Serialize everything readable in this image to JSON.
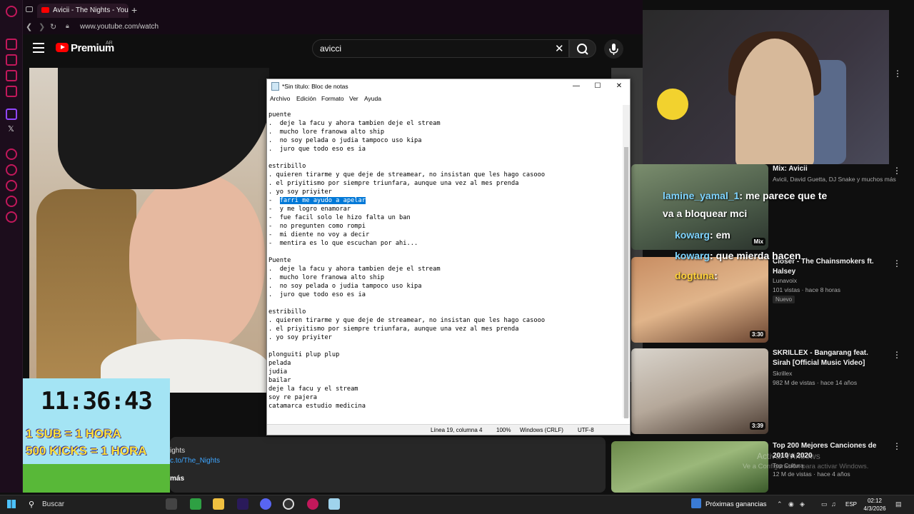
{
  "browser": {
    "tab_title": "Avicii - The Nights - YouTu",
    "url": "www.youtube.com/watch",
    "new_tab": "+"
  },
  "youtube": {
    "brand": "Premium",
    "country": "AR",
    "search_value": "avicci"
  },
  "overlay": {
    "timer": "11:36:43",
    "line1": "1 SUB = 1 HORA",
    "line2": "500 KICKS = 1 HORA"
  },
  "description": {
    "nights": "ights",
    "link": "c.to/The_Nights",
    "more": "más"
  },
  "notepad": {
    "title": "*Sin título: Bloc de notas",
    "menu": [
      "Archivo",
      "Edición",
      "Formato",
      "Ver",
      "Ayuda"
    ],
    "lines_before": "puente\n.  deje la facu y ahora tambien deje el stream\n.  mucho lore franowa alto ship\n.  no soy pelada o judia tampoco uso kipa\n.  juro que todo eso es ia\n\nestribillo\n. quieren tirarme y que deje de streamear, no insistan que les hago casooo\n. el priyitismo por siempre triunfara, aunque una vez al mes prenda\n. yo soy priyiter\n",
    "selected_prefix": "-  ",
    "selected": "farri me ayudo a apelar",
    "lines_after": "\n-  y me logro enamorar\n-  fue facil solo le hizo falta un ban\n-  no pregunten como rompi\n-  mi diente no voy a decir\n-  mentira es lo que escuchan por ahi...\n\nPuente\n.  deje la facu y ahora tambien deje el stream\n.  mucho lore franowa alto ship\n.  no soy pelada o judia tampoco uso kipa\n.  juro que todo eso es ia\n\nestribillo\n. quieren tirarme y que deje de streamear, no insistan que les hago casooo\n. el priyitismo por siempre triunfara, aunque una vez al mes prenda\n. yo soy priyiter\n\nplonguiti plup plup\npelada\njudia\nbailar\ndeje la facu y el stream\nsoy re pajera\ncatamarca estudio medicina",
    "status_position": "Línea 19, columna 4",
    "status_zoom": "100%",
    "status_eol": "Windows (CRLF)",
    "status_encoding": "UTF-8"
  },
  "recommendations": [
    {
      "title": "Mix: Avicii",
      "meta1": "Avicii, David Guetta, DJ Snake y muchos más",
      "meta2": "",
      "duration": "Mix"
    },
    {
      "title": "Closer - The Chainsmokers ft. Halsey",
      "meta1": "Lunavoix",
      "meta2": "101 vistas · hace 8 horas",
      "badge": "Nuevo",
      "duration": "3:30"
    },
    {
      "title": "SKRILLEX - Bangarang feat. Sirah [Official Music Video]",
      "meta1": "Skrillex",
      "meta2": "982 M de vistas · hace 14 años",
      "duration": "3:39"
    },
    {
      "title": "Top 200 Mejores Canciones de 2010 a 2020",
      "meta1": "Top Cultura",
      "meta2": "12 M de vistas · hace 4 años",
      "duration": ""
    }
  ],
  "chat": [
    {
      "user": "lamine_yamal_1",
      "message": ": me parece que te"
    },
    {
      "user": "",
      "message": "va a bloquear mci"
    },
    {
      "user": "kowarg",
      "message": ": em"
    },
    {
      "user": "kowarg",
      "message": ": que mierda hacen"
    },
    {
      "user": "dogtuna",
      "message": ":"
    }
  ],
  "windows_watermark": {
    "line1": "Activar Windows",
    "line2": "Ve a Configuración para activar Windows."
  },
  "taskbar": {
    "search": "Buscar",
    "news": "Próximas ganancias",
    "lang": "ESP",
    "time": "02:12",
    "date": "4/3/2026"
  }
}
